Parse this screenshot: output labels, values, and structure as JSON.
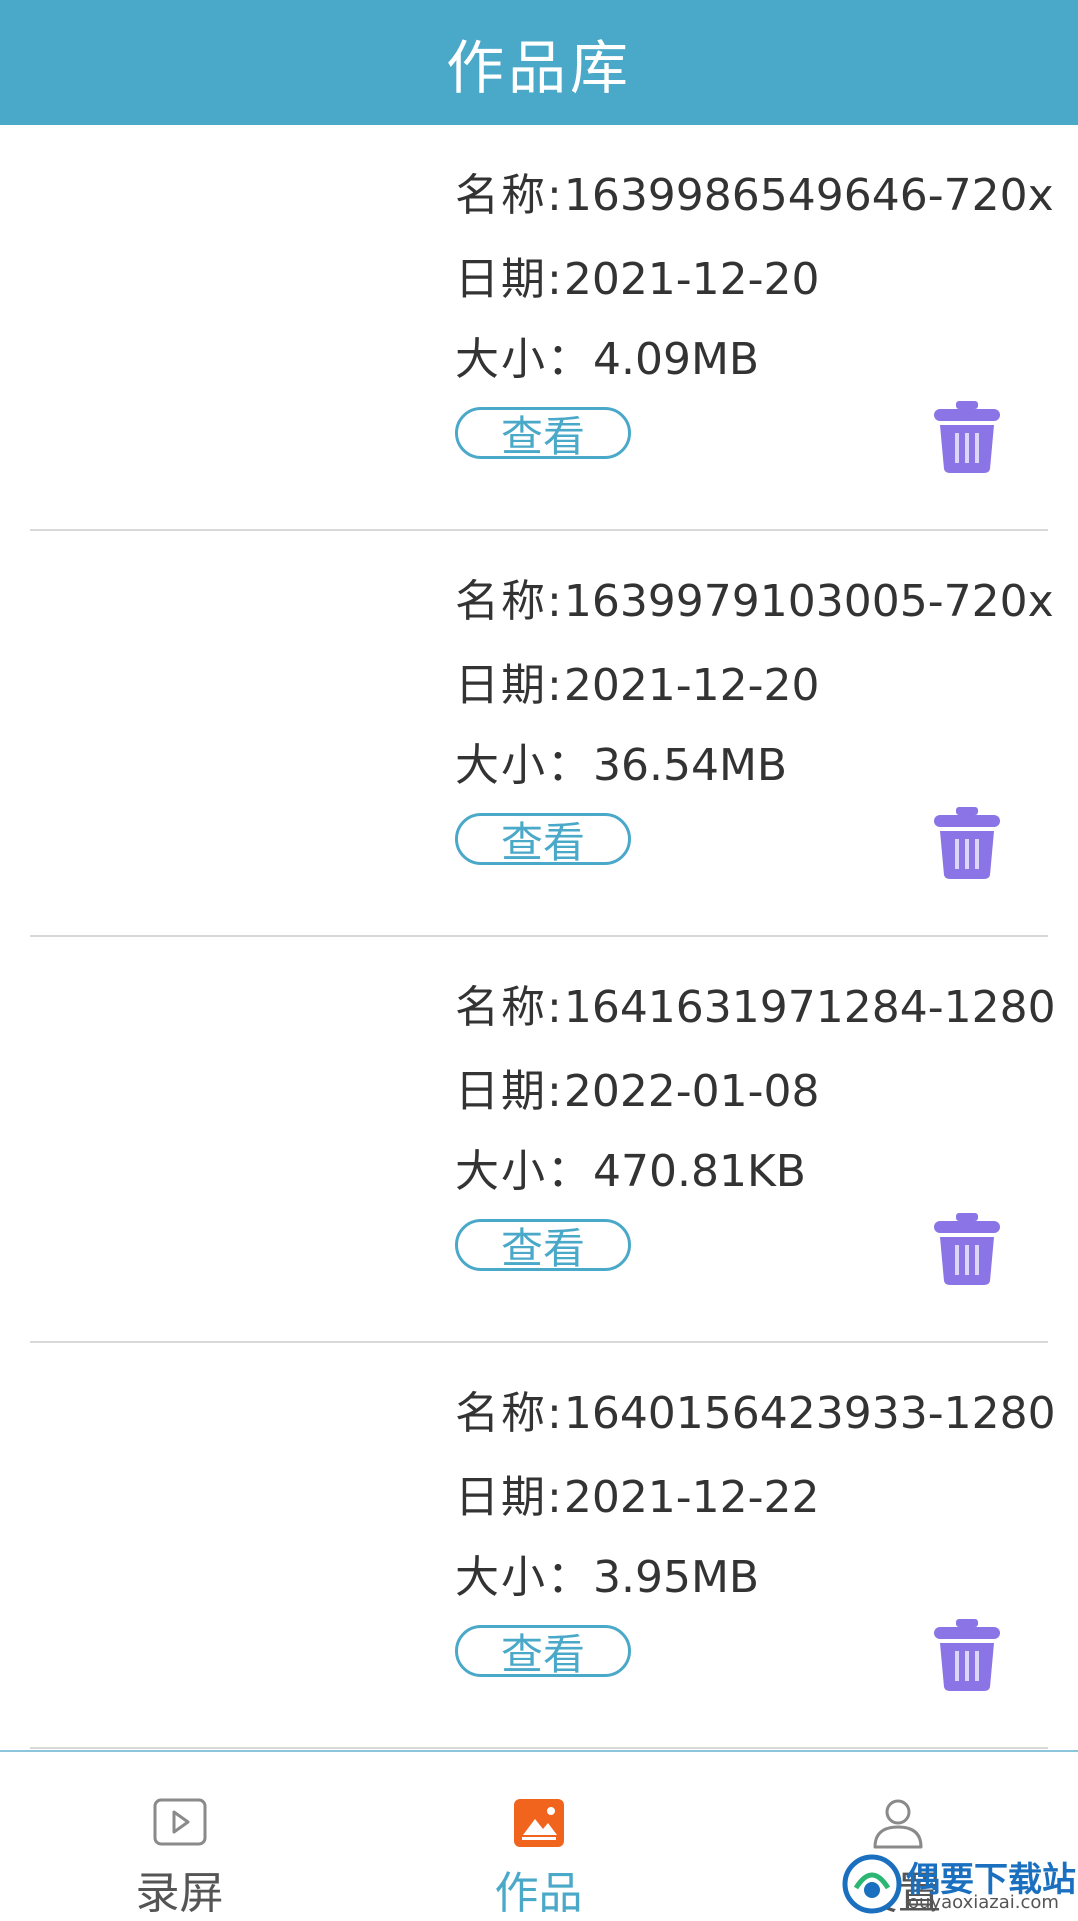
{
  "header": {
    "title": "作品库"
  },
  "items": [
    {
      "name_label": "名称:",
      "name": "1639986549646-720x",
      "date_label": "日期:",
      "date": "2021-12-20",
      "size_label": "大小：",
      "size": "4.09MB",
      "view_label": "查看"
    },
    {
      "name_label": "名称:",
      "name": "1639979103005-720x",
      "date_label": "日期:",
      "date": "2021-12-20",
      "size_label": "大小：",
      "size": "36.54MB",
      "view_label": "查看"
    },
    {
      "name_label": "名称:",
      "name": "1641631971284-1280",
      "date_label": "日期:",
      "date": "2022-01-08",
      "size_label": "大小：",
      "size": "470.81KB",
      "view_label": "查看"
    },
    {
      "name_label": "名称:",
      "name": "1640156423933-1280",
      "date_label": "日期:",
      "date": "2021-12-22",
      "size_label": "大小：",
      "size": "3.95MB",
      "view_label": "查看"
    }
  ],
  "tabs": [
    {
      "label": "录屏",
      "icon": "play-icon"
    },
    {
      "label": "作品",
      "icon": "gallery-icon",
      "active": true
    },
    {
      "label": "设置",
      "icon": "user-icon"
    }
  ],
  "watermark": {
    "title": "偶要下载站",
    "url": "ouyaoxiazai.com"
  },
  "colors": {
    "header": "#4aa8c8",
    "accent": "#4aa8c8",
    "trash": "#8b75e6",
    "gallery_icon": "#f0641e"
  }
}
